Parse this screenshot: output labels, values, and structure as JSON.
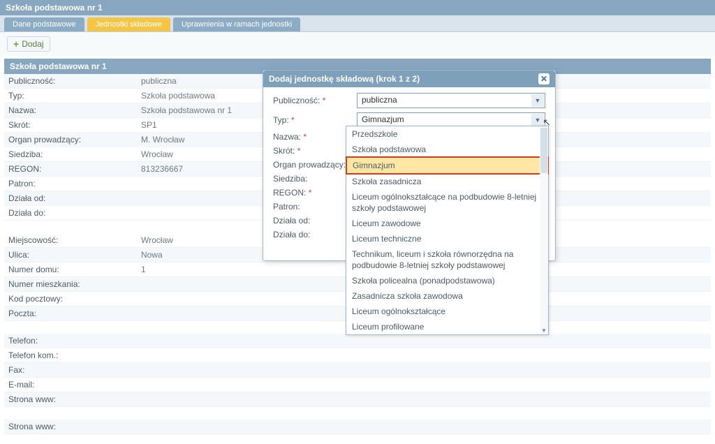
{
  "page_title": "Szkoła podstawowa nr 1",
  "tabs": [
    {
      "label": "Dane podstawowe"
    },
    {
      "label": "Jednostki składowe"
    },
    {
      "label": "Uprawnienia w ramach jednostki"
    }
  ],
  "toolbar": {
    "add_label": "Dodaj"
  },
  "section_header": "Szkoła podstawowa nr 1",
  "details": {
    "publicznosc": {
      "label": "Publiczność:",
      "value": "publiczna"
    },
    "typ": {
      "label": "Typ:",
      "value": "Szkoła podstawowa"
    },
    "nazwa": {
      "label": "Nazwa:",
      "value": "Szkoła podstawowa nr 1"
    },
    "skrot": {
      "label": "Skrót:",
      "value": "SP1"
    },
    "organ": {
      "label": "Organ prowadzący:",
      "value": "M. Wrocław"
    },
    "siedziba": {
      "label": "Siedziba:",
      "value": "Wrocław"
    },
    "regon": {
      "label": "REGON:",
      "value": "813236667"
    },
    "patron": {
      "label": "Patron:",
      "value": ""
    },
    "dziala_od": {
      "label": "Działa od:",
      "value": ""
    },
    "dziala_do": {
      "label": "Działa do:",
      "value": ""
    },
    "miejscowosc": {
      "label": "Miejscowość:",
      "value": "Wrocław"
    },
    "ulica": {
      "label": "Ulica:",
      "value": "Nowa"
    },
    "numer_domu": {
      "label": "Numer domu:",
      "value": "1"
    },
    "numer_mieszkania": {
      "label": "Numer mieszkania:",
      "value": ""
    },
    "kod": {
      "label": "Kod pocztowy:",
      "value": ""
    },
    "poczta": {
      "label": "Poczta:",
      "value": ""
    },
    "telefon": {
      "label": "Telefon:",
      "value": ""
    },
    "telefon_kom": {
      "label": "Telefon kom.:",
      "value": ""
    },
    "fax": {
      "label": "Fax:",
      "value": ""
    },
    "email": {
      "label": "E-mail:",
      "value": ""
    },
    "www": {
      "label": "Strona www:",
      "value": ""
    },
    "www2": {
      "label": "Strona www:",
      "value": ""
    }
  },
  "dialog": {
    "title": "Dodaj jednostkę składową (krok 1 z 2)",
    "fields": {
      "publicznosc": {
        "label": "Publiczność:",
        "value": "publiczna"
      },
      "typ": {
        "label": "Typ:",
        "value": "Gimnazjum"
      },
      "nazwa": {
        "label": "Nazwa:"
      },
      "skrot": {
        "label": "Skrót:"
      },
      "organ": {
        "label": "Organ prowadzący:"
      },
      "siedziba": {
        "label": "Siedziba:"
      },
      "regon": {
        "label": "REGON:"
      },
      "patron": {
        "label": "Patron:"
      },
      "dziala_od": {
        "label": "Działa od:"
      },
      "dziala_do": {
        "label": "Działa do:"
      }
    }
  },
  "dropdown": {
    "items": [
      "Przedszkole",
      "Szkoła podstawowa",
      "Gimnazjum",
      "Szkoła zasadnicza",
      "Liceum ogólnokształcące na podbudowie 8-letniej szkoły podstawowej",
      "Liceum zawodowe",
      "Liceum techniczne",
      "Technikum, liceum i szkoła równorzędna na podbudowie 8-letniej szkoły podstawowej",
      "Szkoła policealna (ponadpodstawowa)",
      "Zasadnicza szkoła zawodowa",
      "Liceum ogólnokształcące",
      "Liceum profilowane"
    ],
    "highlighted_index": 2
  }
}
